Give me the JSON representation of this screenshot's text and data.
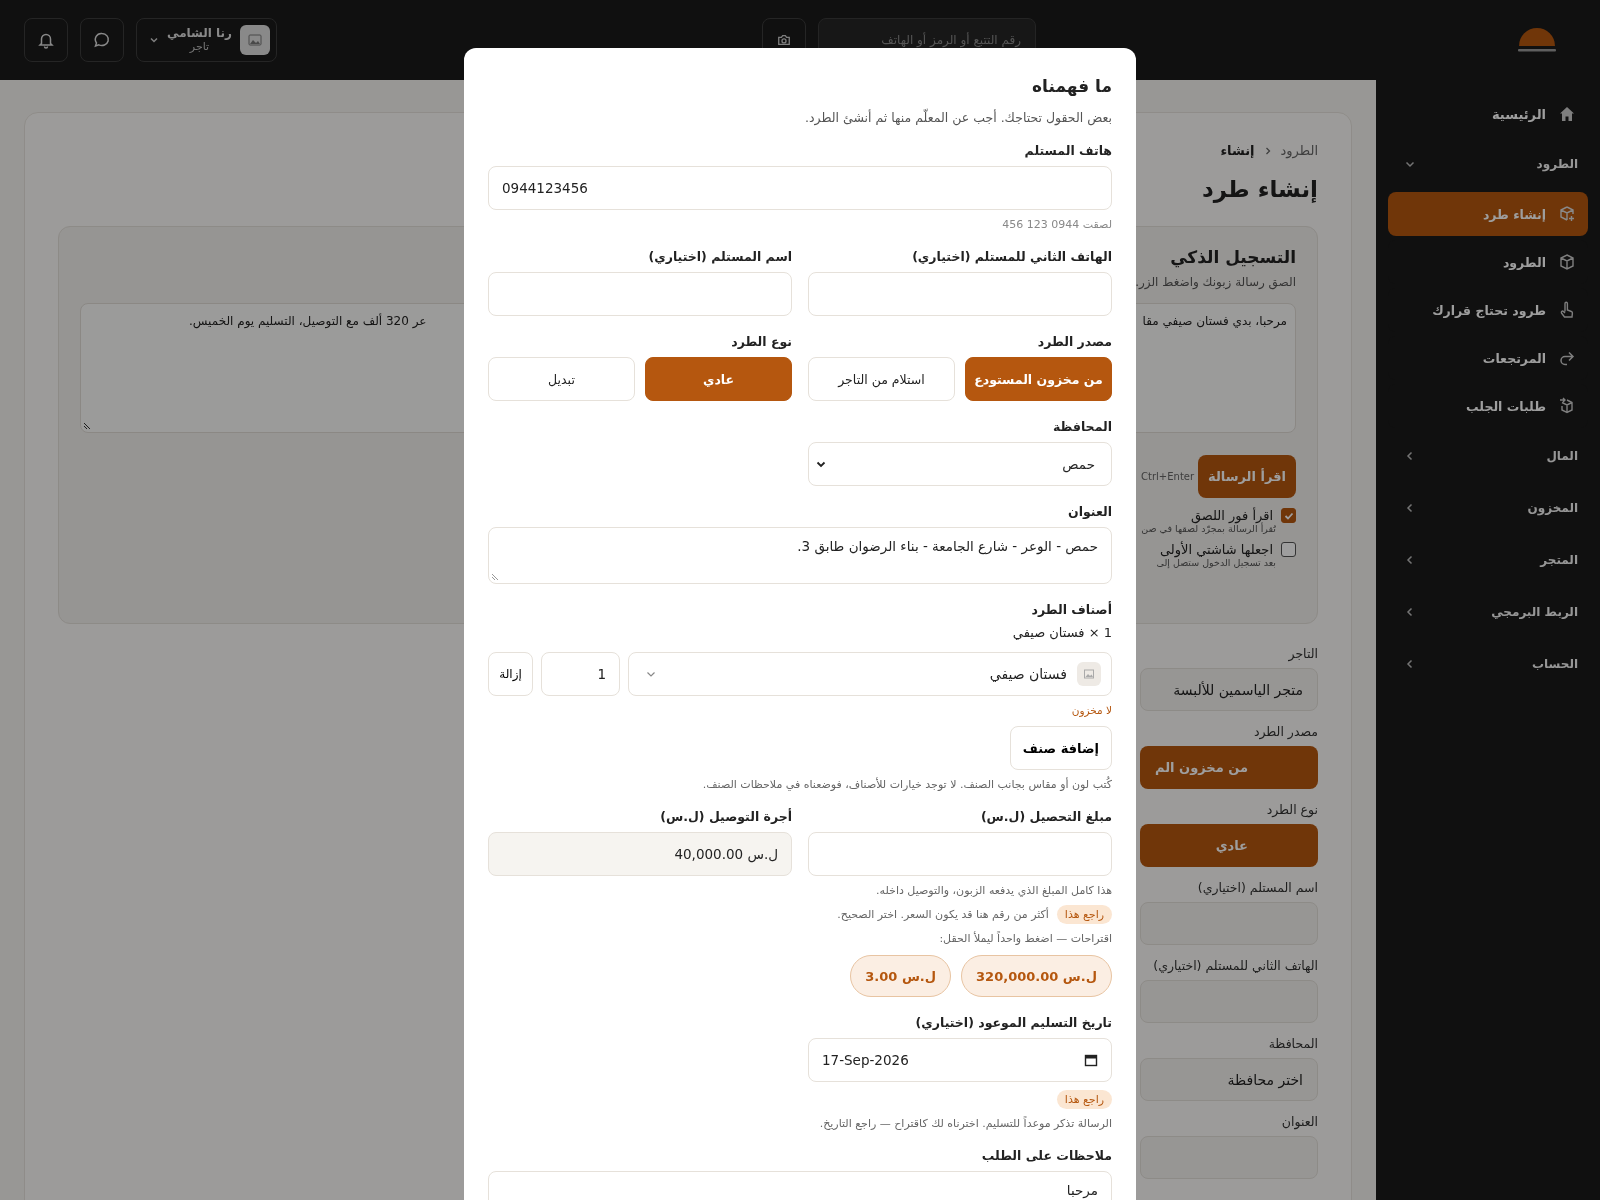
{
  "topbar": {
    "search": {
      "placeholder": "رقم التتبع أو الرمز أو الهاتف"
    },
    "user": {
      "name": "رنا الشامي",
      "role": "تاجر"
    }
  },
  "sidebar": {
    "items": [
      {
        "kind": "link",
        "label": "الرئيسية",
        "selected": false
      },
      {
        "kind": "section",
        "label": "الطرود",
        "expanded": true,
        "children": [
          {
            "label": "إنشاء طرد",
            "selected": true
          },
          {
            "label": "الطرود",
            "selected": false
          },
          {
            "label": "طرود تحتاج قرارك",
            "selected": false
          },
          {
            "label": "المرتجعات",
            "selected": false
          },
          {
            "label": "طلبات الجلب",
            "selected": false
          }
        ]
      },
      {
        "kind": "section",
        "label": "المال",
        "expanded": false
      },
      {
        "kind": "section",
        "label": "المخزون",
        "expanded": false
      },
      {
        "kind": "section",
        "label": "المتجر",
        "expanded": false
      },
      {
        "kind": "section",
        "label": "الربط البرمجي",
        "expanded": false
      },
      {
        "kind": "section",
        "label": "الحساب",
        "expanded": false
      }
    ]
  },
  "page": {
    "breadcrumb": [
      {
        "label": "الطرود",
        "current": false
      },
      {
        "label": "إنشاء",
        "current": true
      }
    ],
    "title": "إنشاء طرد",
    "smart_entry": {
      "title": "التسجيل الذكي",
      "subtitle": "الصق رسالة زبونك واضغط الزر.",
      "message_start": "مرحبا، بدي فستان صيفي مقا",
      "message_end": "عر 320 ألف مع التوصيل، التسليم يوم الخميس.",
      "button": "اقرأ الرسالة",
      "shortcut": "Ctrl+Enter",
      "options": [
        {
          "label": "اقرأ فور اللصق",
          "hint": "تُقرأ الرسالة بمجرّد لصقها في صن",
          "checked": true
        },
        {
          "label": "اجعلها شاشتي الأولى",
          "hint": "بعد تسجيل الدخول ستصل إلى",
          "checked": false
        }
      ]
    },
    "fields": [
      {
        "kind": "input",
        "label": "التاجر",
        "value": "متجر الياسمين للألبسة"
      },
      {
        "kind": "choice",
        "label": "مصدر الطرد",
        "value": "من مخزون الم"
      },
      {
        "kind": "choice",
        "label": "نوع الطرد",
        "value": "عادي"
      },
      {
        "kind": "input",
        "label": "اسم المستلم (اختياري)"
      },
      {
        "kind": "input",
        "label": "الهاتف الثاني للمستلم (اختياري)"
      },
      {
        "kind": "select",
        "label": "المحافظة",
        "value": "اختر محافظة"
      },
      {
        "kind": "input",
        "label": "العنوان"
      }
    ]
  },
  "dialog": {
    "title": "ما فهمناه",
    "subtitle": "بعض الحقول تحتاجك. أجب عن المعلّم منها ثم أنشئ الطرد.",
    "phone": {
      "label": "هاتف المستلم",
      "value": "0944123456",
      "hint": "لصقت 0944 123 456"
    },
    "second_phone": {
      "label": "الهاتف الثاني للمستلم (اختياري)"
    },
    "name": {
      "label": "اسم المستلم (اختياري)"
    },
    "source": {
      "label": "مصدر الطرد",
      "options": [
        {
          "label": "من مخزون المستودع",
          "selected": true
        },
        {
          "label": "استلام من التاجر",
          "selected": false
        }
      ]
    },
    "type": {
      "label": "نوع الطرد",
      "options": [
        {
          "label": "عادي",
          "selected": true
        },
        {
          "label": "تبديل",
          "selected": false
        }
      ]
    },
    "governorate": {
      "label": "المحافظة",
      "value": "حمص"
    },
    "address": {
      "label": "العنوان",
      "value": "حمص - الوعر - شارع الجامعة - بناء الرضوان طابق 3."
    },
    "items": {
      "label": "أصناف الطرد",
      "summary": "1 × فستان صيفي",
      "rows": [
        {
          "product": "فستان صيفي",
          "quantity": "1",
          "remove": "إزالة",
          "warning": "لا مخزون"
        }
      ],
      "add_button": "إضافة صنف",
      "note": "كُتب لون أو مقاس بجانب الصنف. لا توجد خيارات للأصناف، فوضعناه في ملاحظات الصنف."
    },
    "cod": {
      "label": "مبلغ التحصيل (ل.س)",
      "hint": "هذا كامل المبلغ الذي يدفعه الزبون، والتوصيل داخله.",
      "badge": "راجع هذا",
      "review": "أكثر من رقم هنا قد يكون السعر. اختر الصحيح.",
      "suggestions_label": "اقتراحات — اضغط واحداً ليملأ الحقل:",
      "suggestions": [
        "ل.س 320,000.00",
        "ل.س 3.00"
      ]
    },
    "delivery_fee": {
      "label": "أجرة التوصيل (ل.س)",
      "value": "ل.س 40,000.00"
    },
    "due_date": {
      "label": "تاريخ التسليم الموعود (اختياري)",
      "value": "17-Sep-2026",
      "badge": "راجع هذا",
      "hint": "الرسالة تذكر موعداً للتسليم. اخترناه لك كاقتراح — راجع التاريخ."
    },
    "notes": {
      "label": "ملاحظات على الطلب",
      "value": "مرحبا"
    }
  }
}
